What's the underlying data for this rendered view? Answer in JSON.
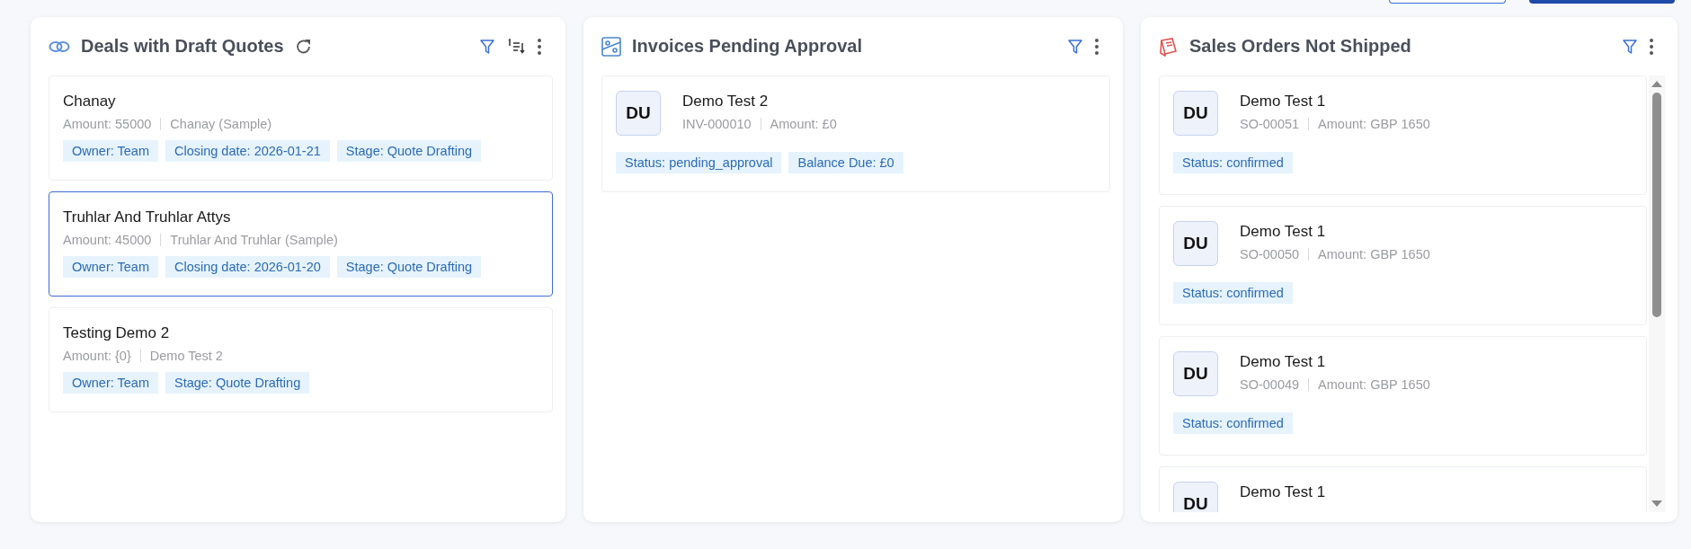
{
  "toolbar_buttons": [
    {
      "kind": "secondary"
    },
    {
      "kind": "primary"
    }
  ],
  "panels": [
    {
      "kind": "deals",
      "title": "Deals with Draft Quotes",
      "tools": [
        {
          "kind": "refresh"
        },
        {
          "kind": "filter"
        },
        {
          "kind": "sort"
        },
        {
          "kind": "more"
        }
      ],
      "items": [
        {
          "name": "Chanay",
          "meta": [
            "Amount: 55000",
            "Chanay (Sample)"
          ],
          "tags": [
            "Owner: Team",
            "Closing date: 2026-01-21",
            "Stage: Quote Drafting"
          ],
          "selected": false
        },
        {
          "name": "Truhlar And Truhlar Attys",
          "meta": [
            "Amount: 45000",
            "Truhlar And Truhlar (Sample)"
          ],
          "tags": [
            "Owner: Team",
            "Closing date: 2026-01-20",
            "Stage: Quote Drafting"
          ],
          "selected": true
        },
        {
          "name": "Testing Demo 2",
          "meta": [
            "Amount: {0}",
            "Demo Test 2"
          ],
          "tags": [
            "Owner: Team",
            "Stage: Quote Drafting"
          ],
          "selected": false
        }
      ]
    },
    {
      "kind": "invoices",
      "title": "Invoices Pending Approval",
      "tools": [
        {
          "kind": "filter"
        },
        {
          "kind": "more"
        }
      ],
      "items": [
        {
          "avatar": "DU",
          "name": "Demo Test 2",
          "meta": [
            "INV-000010",
            "Amount: £0"
          ],
          "tags": [
            "Status: pending_approval",
            "Balance Due: £0"
          ]
        }
      ]
    },
    {
      "kind": "orders",
      "title": "Sales Orders Not Shipped",
      "tools": [
        {
          "kind": "filter"
        },
        {
          "kind": "more"
        }
      ],
      "items": [
        {
          "avatar": "DU",
          "name": "Demo Test 1",
          "meta": [
            "SO-00051",
            "Amount: GBP 1650"
          ],
          "tags": [
            "Status: confirmed"
          ]
        },
        {
          "avatar": "DU",
          "name": "Demo Test 1",
          "meta": [
            "SO-00050",
            "Amount: GBP 1650"
          ],
          "tags": [
            "Status: confirmed"
          ]
        },
        {
          "avatar": "DU",
          "name": "Demo Test 1",
          "meta": [
            "SO-00049",
            "Amount: GBP 1650"
          ],
          "tags": [
            "Status: confirmed"
          ]
        },
        {
          "avatar": "DU",
          "name": "Demo Test 1"
        }
      ]
    }
  ]
}
